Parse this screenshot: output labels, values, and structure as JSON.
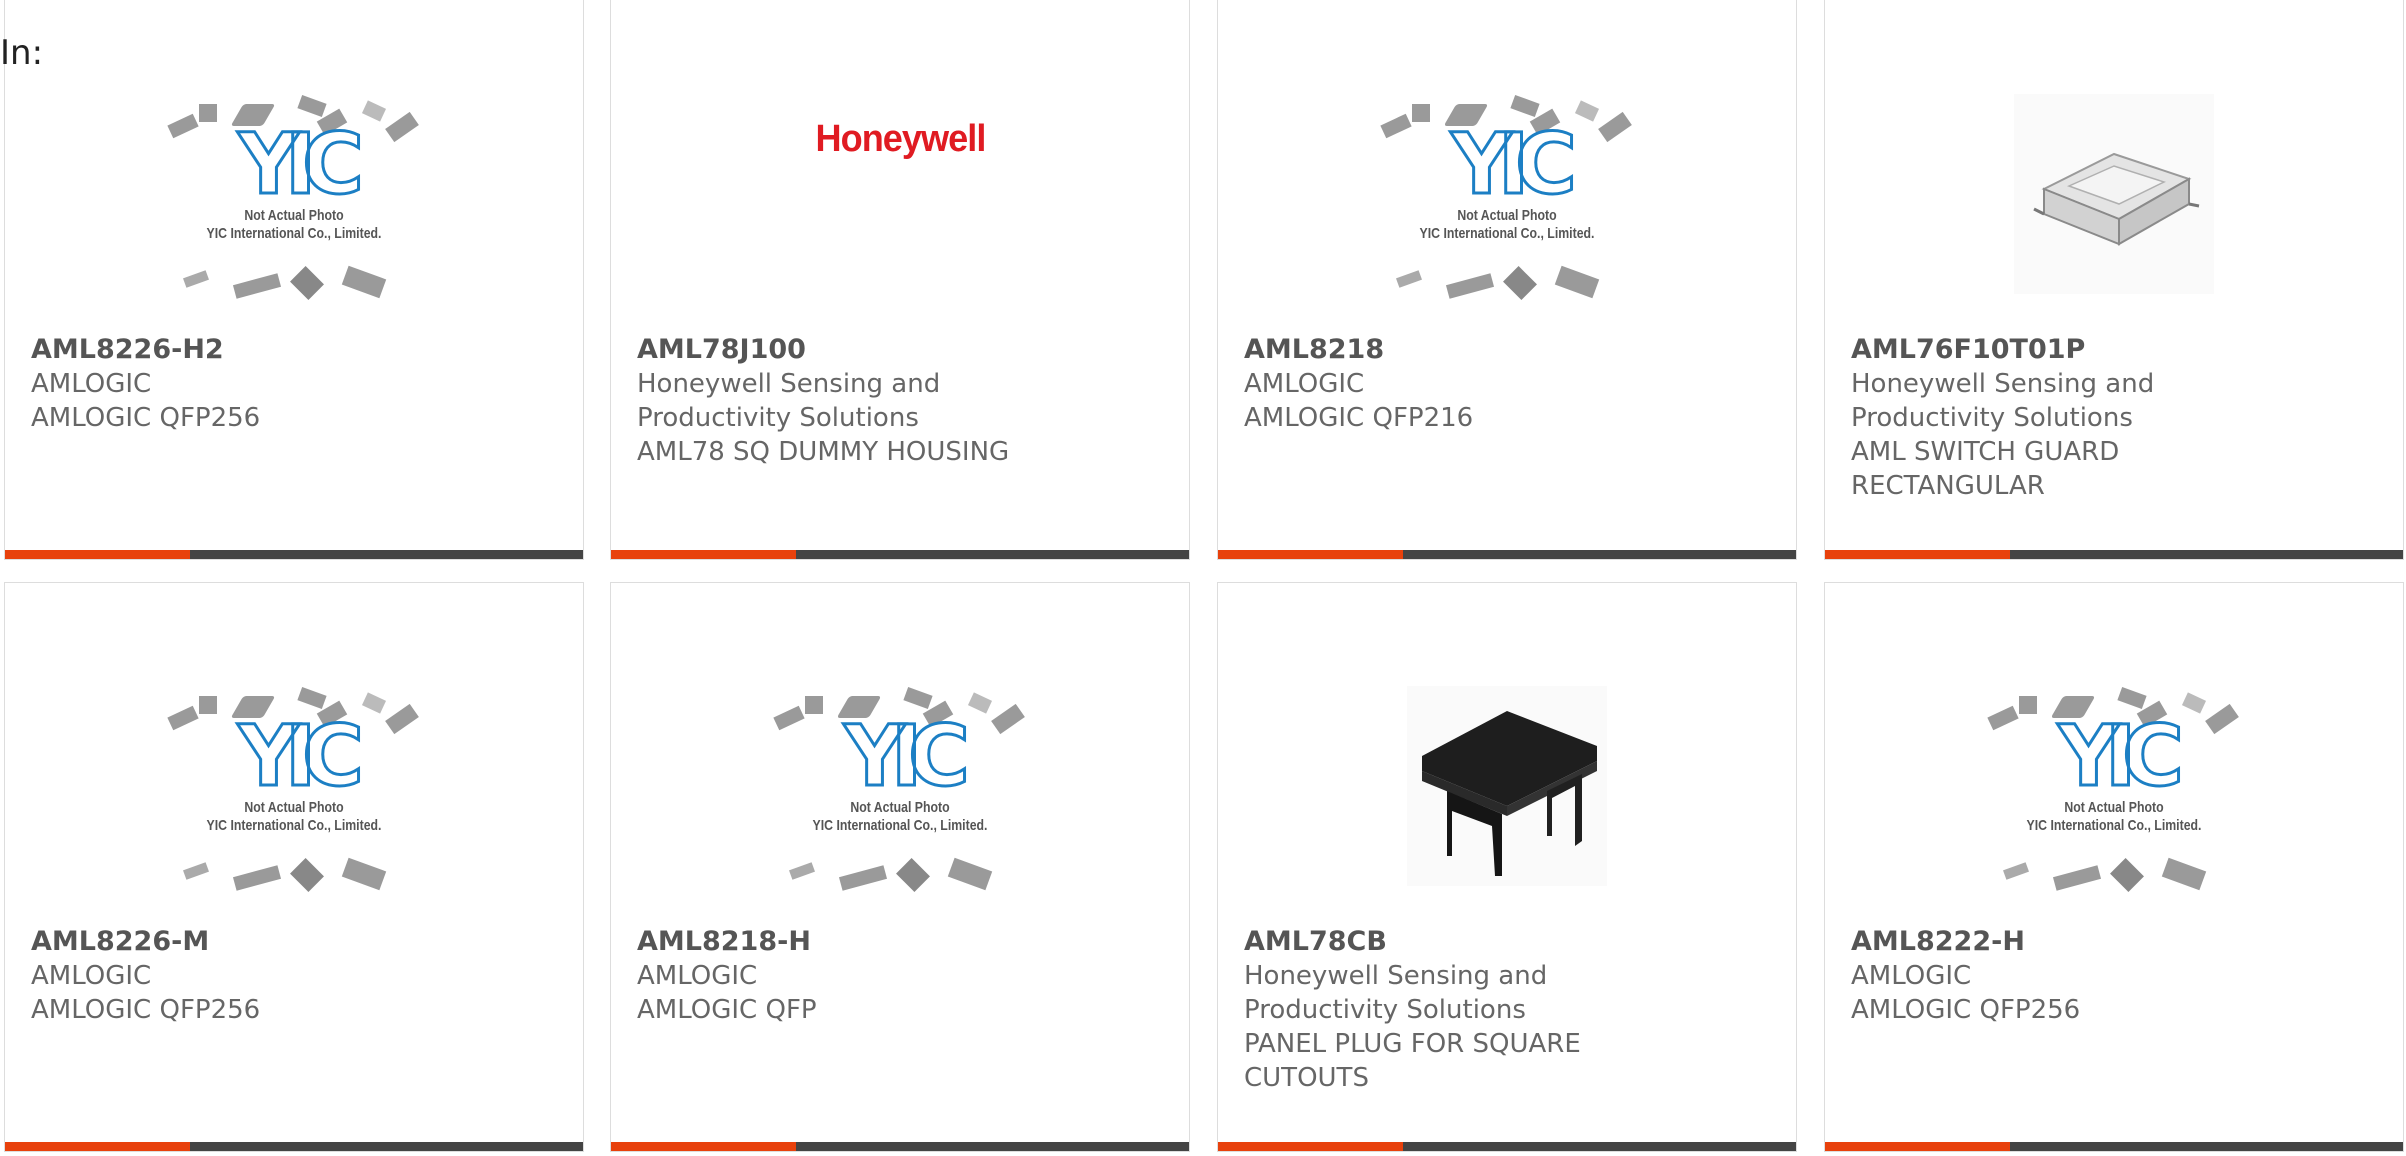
{
  "filter_label": "In:",
  "placeholder_caption": {
    "line1": "Not Actual Photo",
    "line2": "YIC International Co., Limited."
  },
  "brand_logo_text": "Honeywell",
  "colors": {
    "accent": "#e8410c",
    "bar": "#444444",
    "yic_blue": "#1c7fc4",
    "honeywell_red": "#e01b22"
  },
  "products": [
    {
      "part": "AML8226-H2",
      "manufacturer": "AMLOGIC",
      "desc_lines": [
        "AMLOGIC QFP256"
      ],
      "image": "yic-placeholder"
    },
    {
      "part": "AML78J100",
      "manufacturer_lines": [
        "Honeywell Sensing and",
        "Productivity Solutions"
      ],
      "desc_lines": [
        "AML78 SQ DUMMY HOUSING"
      ],
      "image": "honeywell-logo"
    },
    {
      "part": "AML8218",
      "manufacturer": "AMLOGIC",
      "desc_lines": [
        "AMLOGIC QFP216"
      ],
      "image": "yic-placeholder"
    },
    {
      "part": "AML76F10T01P",
      "manufacturer_lines": [
        "Honeywell Sensing and",
        "Productivity Solutions"
      ],
      "desc_lines": [
        "AML SWITCH GUARD",
        "RECTANGULAR"
      ],
      "image": "switch-guard-photo"
    },
    {
      "part": "AML8226-M",
      "manufacturer": "AMLOGIC",
      "desc_lines": [
        "AMLOGIC QFP256"
      ],
      "image": "yic-placeholder"
    },
    {
      "part": "AML8218-H",
      "manufacturer": "AMLOGIC",
      "desc_lines": [
        "AMLOGIC QFP"
      ],
      "image": "yic-placeholder"
    },
    {
      "part": "AML78CB",
      "manufacturer_lines": [
        "Honeywell Sensing and",
        "Productivity Solutions"
      ],
      "desc_lines": [
        "PANEL PLUG FOR SQUARE",
        "CUTOUTS"
      ],
      "image": "panel-plug-photo"
    },
    {
      "part": "AML8222-H",
      "manufacturer": "AMLOGIC",
      "desc_lines": [
        "AMLOGIC QFP256"
      ],
      "image": "yic-placeholder"
    }
  ]
}
